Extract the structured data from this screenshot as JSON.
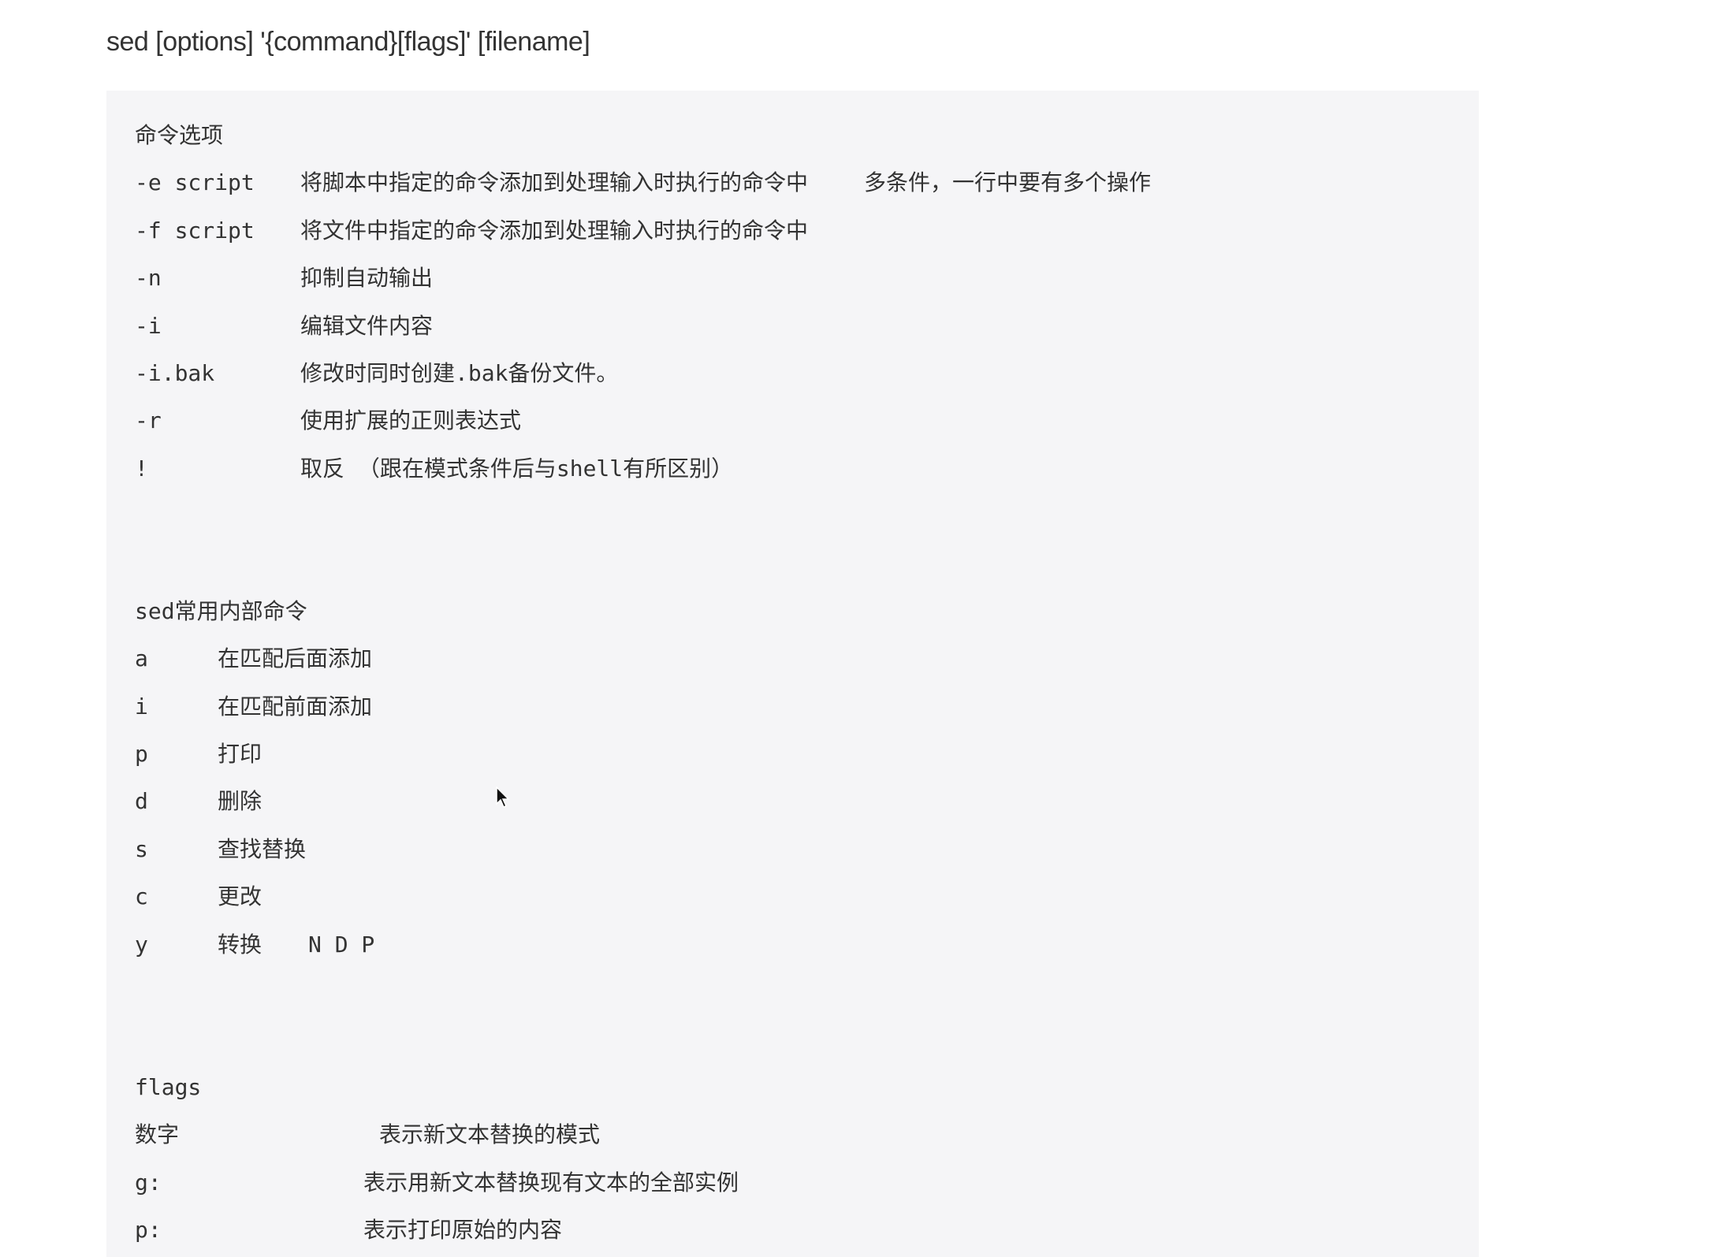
{
  "title": "sed [options] '{command}[flags]' [filename]",
  "options": {
    "heading": "命令选项",
    "items": [
      {
        "key": "-e script",
        "desc": "将脚本中指定的命令添加到处理输入时执行的命令中",
        "note": "多条件，一行中要有多个操作"
      },
      {
        "key": "-f script",
        "desc": "将文件中指定的命令添加到处理输入时执行的命令中"
      },
      {
        "key": "-n",
        "desc": "抑制自动输出"
      },
      {
        "key": "-i",
        "desc": "编辑文件内容"
      },
      {
        "key": "-i.bak",
        "desc": "修改时同时创建.bak备份文件。"
      },
      {
        "key": "-r",
        "desc": "使用扩展的正则表达式"
      },
      {
        "key": "!",
        "desc": "取反 （跟在模式条件后与shell有所区别）"
      }
    ]
  },
  "commands": {
    "heading": "sed常用内部命令",
    "items": [
      {
        "key": "a",
        "desc": "在匹配后面添加"
      },
      {
        "key": "i",
        "desc": "在匹配前面添加"
      },
      {
        "key": "p",
        "desc": "打印"
      },
      {
        "key": "d",
        "desc": "删除"
      },
      {
        "key": "s",
        "desc": "查找替换"
      },
      {
        "key": "c",
        "desc": "更改"
      },
      {
        "key": "y",
        "desc": "转换",
        "note": "N D P"
      }
    ]
  },
  "flags": {
    "heading": "flags",
    "items": [
      {
        "key": "数字",
        "desc": "表示新文本替换的模式"
      },
      {
        "key": "g:",
        "desc": "表示用新文本替换现有文本的全部实例"
      },
      {
        "key": "p:",
        "desc": "表示打印原始的内容"
      }
    ]
  },
  "cursor_icon": "mouse-pointer-icon"
}
